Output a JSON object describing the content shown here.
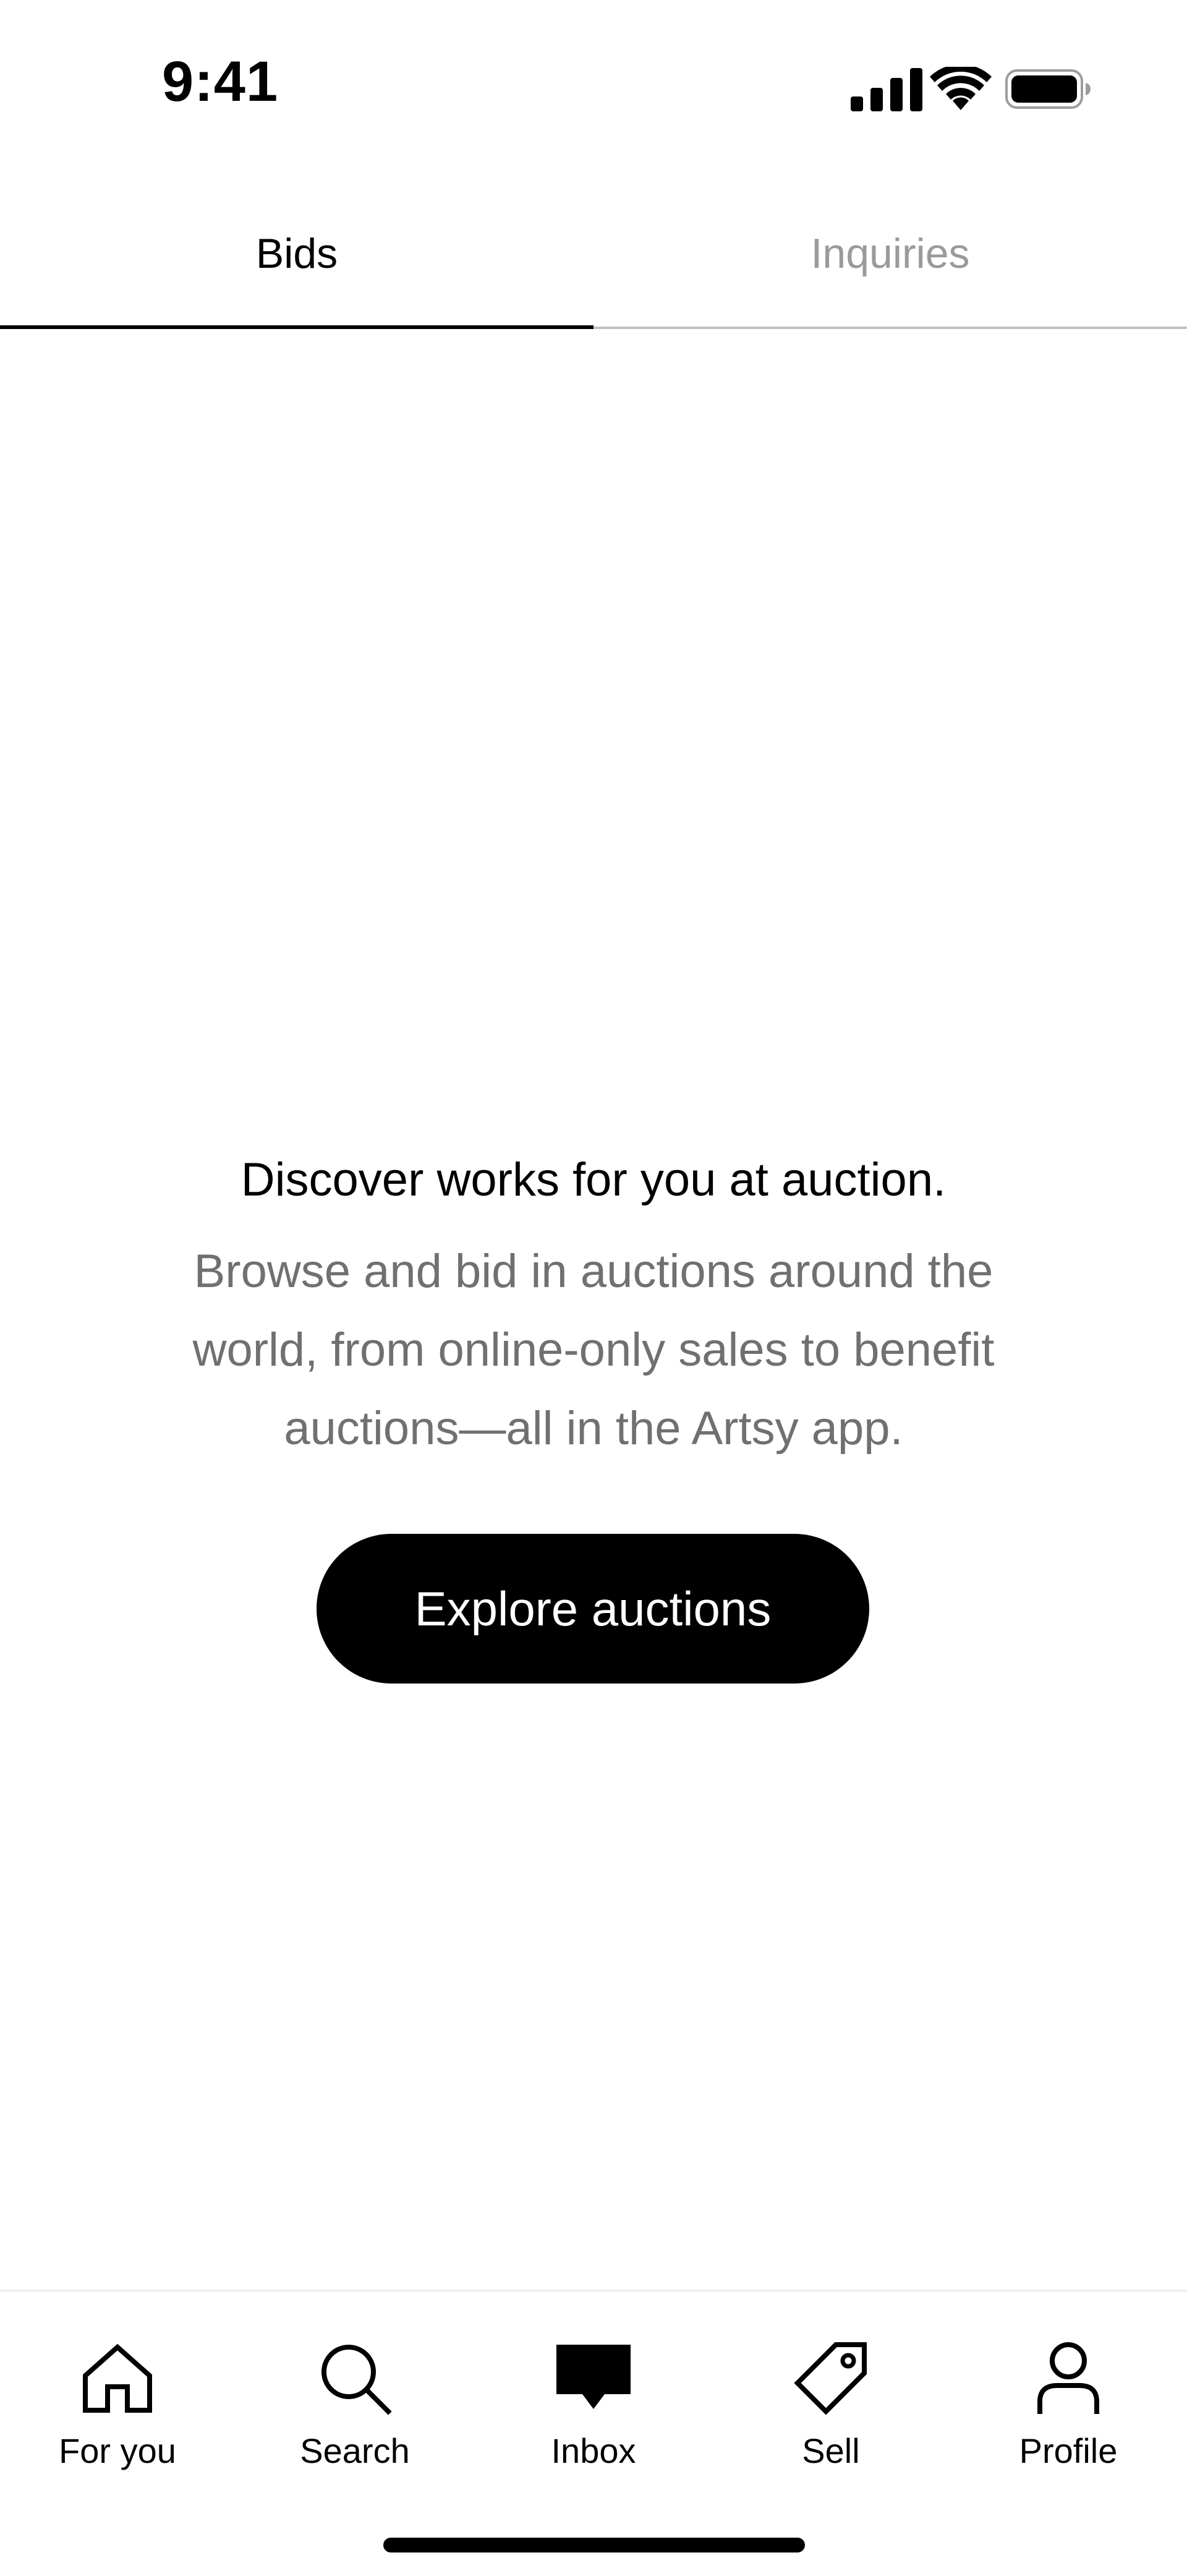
{
  "status_bar": {
    "time": "9:41",
    "icons": [
      "cellular-signal-icon",
      "wifi-icon",
      "battery-icon"
    ]
  },
  "tabs": [
    {
      "label": "Bids",
      "active": true
    },
    {
      "label": "Inquiries",
      "active": false
    }
  ],
  "empty_state": {
    "title": "Discover works for you at auction.",
    "description": "Browse and bid in auctions around the world, from online-only sales to benefit auctions—all in the Artsy app.",
    "button_label": "Explore auctions"
  },
  "bottom_nav": {
    "items": [
      {
        "label": "For you",
        "icon": "home-icon",
        "active": false
      },
      {
        "label": "Search",
        "icon": "search-icon",
        "active": false
      },
      {
        "label": "Inbox",
        "icon": "inbox-icon",
        "active": true
      },
      {
        "label": "Sell",
        "icon": "tag-icon",
        "active": false
      },
      {
        "label": "Profile",
        "icon": "profile-icon",
        "active": false
      }
    ]
  },
  "colors": {
    "text_primary": "#000000",
    "text_secondary": "#707070",
    "tab_inactive": "#9a9a9a",
    "button_bg": "#000000",
    "button_text": "#ffffff",
    "background": "#ffffff"
  }
}
